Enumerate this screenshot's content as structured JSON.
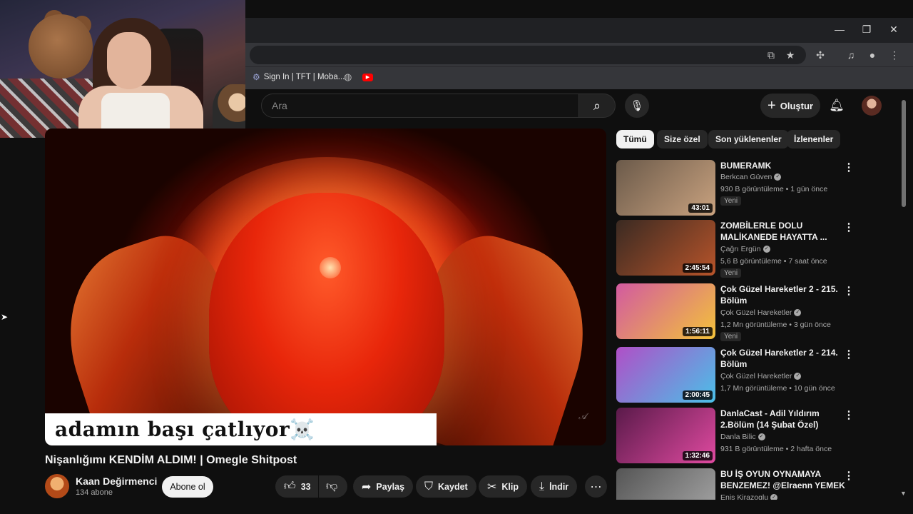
{
  "browser": {
    "bookmarks": [
      {
        "label": "Sign In | TFT | Moba...",
        "icon": "tft-icon"
      },
      {
        "label": "",
        "icon": "globe-icon"
      },
      {
        "label": "",
        "icon": "youtube-icon"
      }
    ]
  },
  "youtube": {
    "search_placeholder": "Ara",
    "create_label": "Oluştur"
  },
  "video": {
    "caption": "adamın başı çatlıyor☠️",
    "title": "Nişanlığımı KENDİM ALDIM! | Omegle Shitpost",
    "channel": "Kaan Değirmenci",
    "subscribers": "134 abone",
    "subscribe_label": "Abone ol",
    "likes": "33",
    "share_label": "Paylaş",
    "save_label": "Kaydet",
    "clip_label": "Klip",
    "download_label": "İndir"
  },
  "chips": [
    "Tümü",
    "Size özel",
    "Son yüklenenler",
    "İzlenenler"
  ],
  "recommendations": [
    {
      "title": "BUMERAMK",
      "channel": "Berkcan Güven",
      "meta": "930 B görüntüleme • 1 gün önce",
      "badge": "Yeni",
      "duration": "43:01",
      "thumb_colors": [
        "#6b5a4a",
        "#c9a27f"
      ]
    },
    {
      "title": "ZOMBİLERLE DOLU MALİKANEDE HAYATTA ...",
      "channel": "Çağrı Ergün",
      "meta": "5,6 B görüntüleme • 7 saat önce",
      "badge": "Yeni",
      "duration": "2:45:54",
      "thumb_colors": [
        "#3a2a22",
        "#b7542a"
      ]
    },
    {
      "title": "Çok Güzel Hareketler 2 - 215. Bölüm",
      "channel": "Çok Güzel Hareketler",
      "meta": "1,2 Mn görüntüleme • 3 gün önce",
      "badge": "Yeni",
      "duration": "1:56:11",
      "thumb_colors": [
        "#d25aa0",
        "#f3c23a"
      ]
    },
    {
      "title": "Çok Güzel Hareketler 2 - 214. Bölüm",
      "channel": "Çok Güzel Hareketler",
      "meta": "1,7 Mn görüntüleme • 10 gün önce",
      "badge": "",
      "duration": "2:00:45",
      "thumb_colors": [
        "#b04fc7",
        "#4ac0e8"
      ]
    },
    {
      "title": "DanlaCast - Adil Yıldırım 2.Bölüm (14 Şubat Özel)",
      "channel": "Danla Bilic",
      "meta": "931 B görüntüleme • 2 hafta önce",
      "badge": "",
      "duration": "1:32:46",
      "thumb_colors": [
        "#5a1a4a",
        "#e04aa0"
      ]
    },
    {
      "title": "BU İŞ OYUN OYNAMAYA BENZEMEZ! @Elraenn YEMEK ...",
      "channel": "Enis Kirazoglu",
      "meta": "",
      "badge": "",
      "duration": "",
      "thumb_colors": [
        "#555",
        "#aaa"
      ]
    }
  ],
  "colors": {
    "accent_red": "#ff0000",
    "bg": "#0f0f0f",
    "chip": "#272727"
  }
}
